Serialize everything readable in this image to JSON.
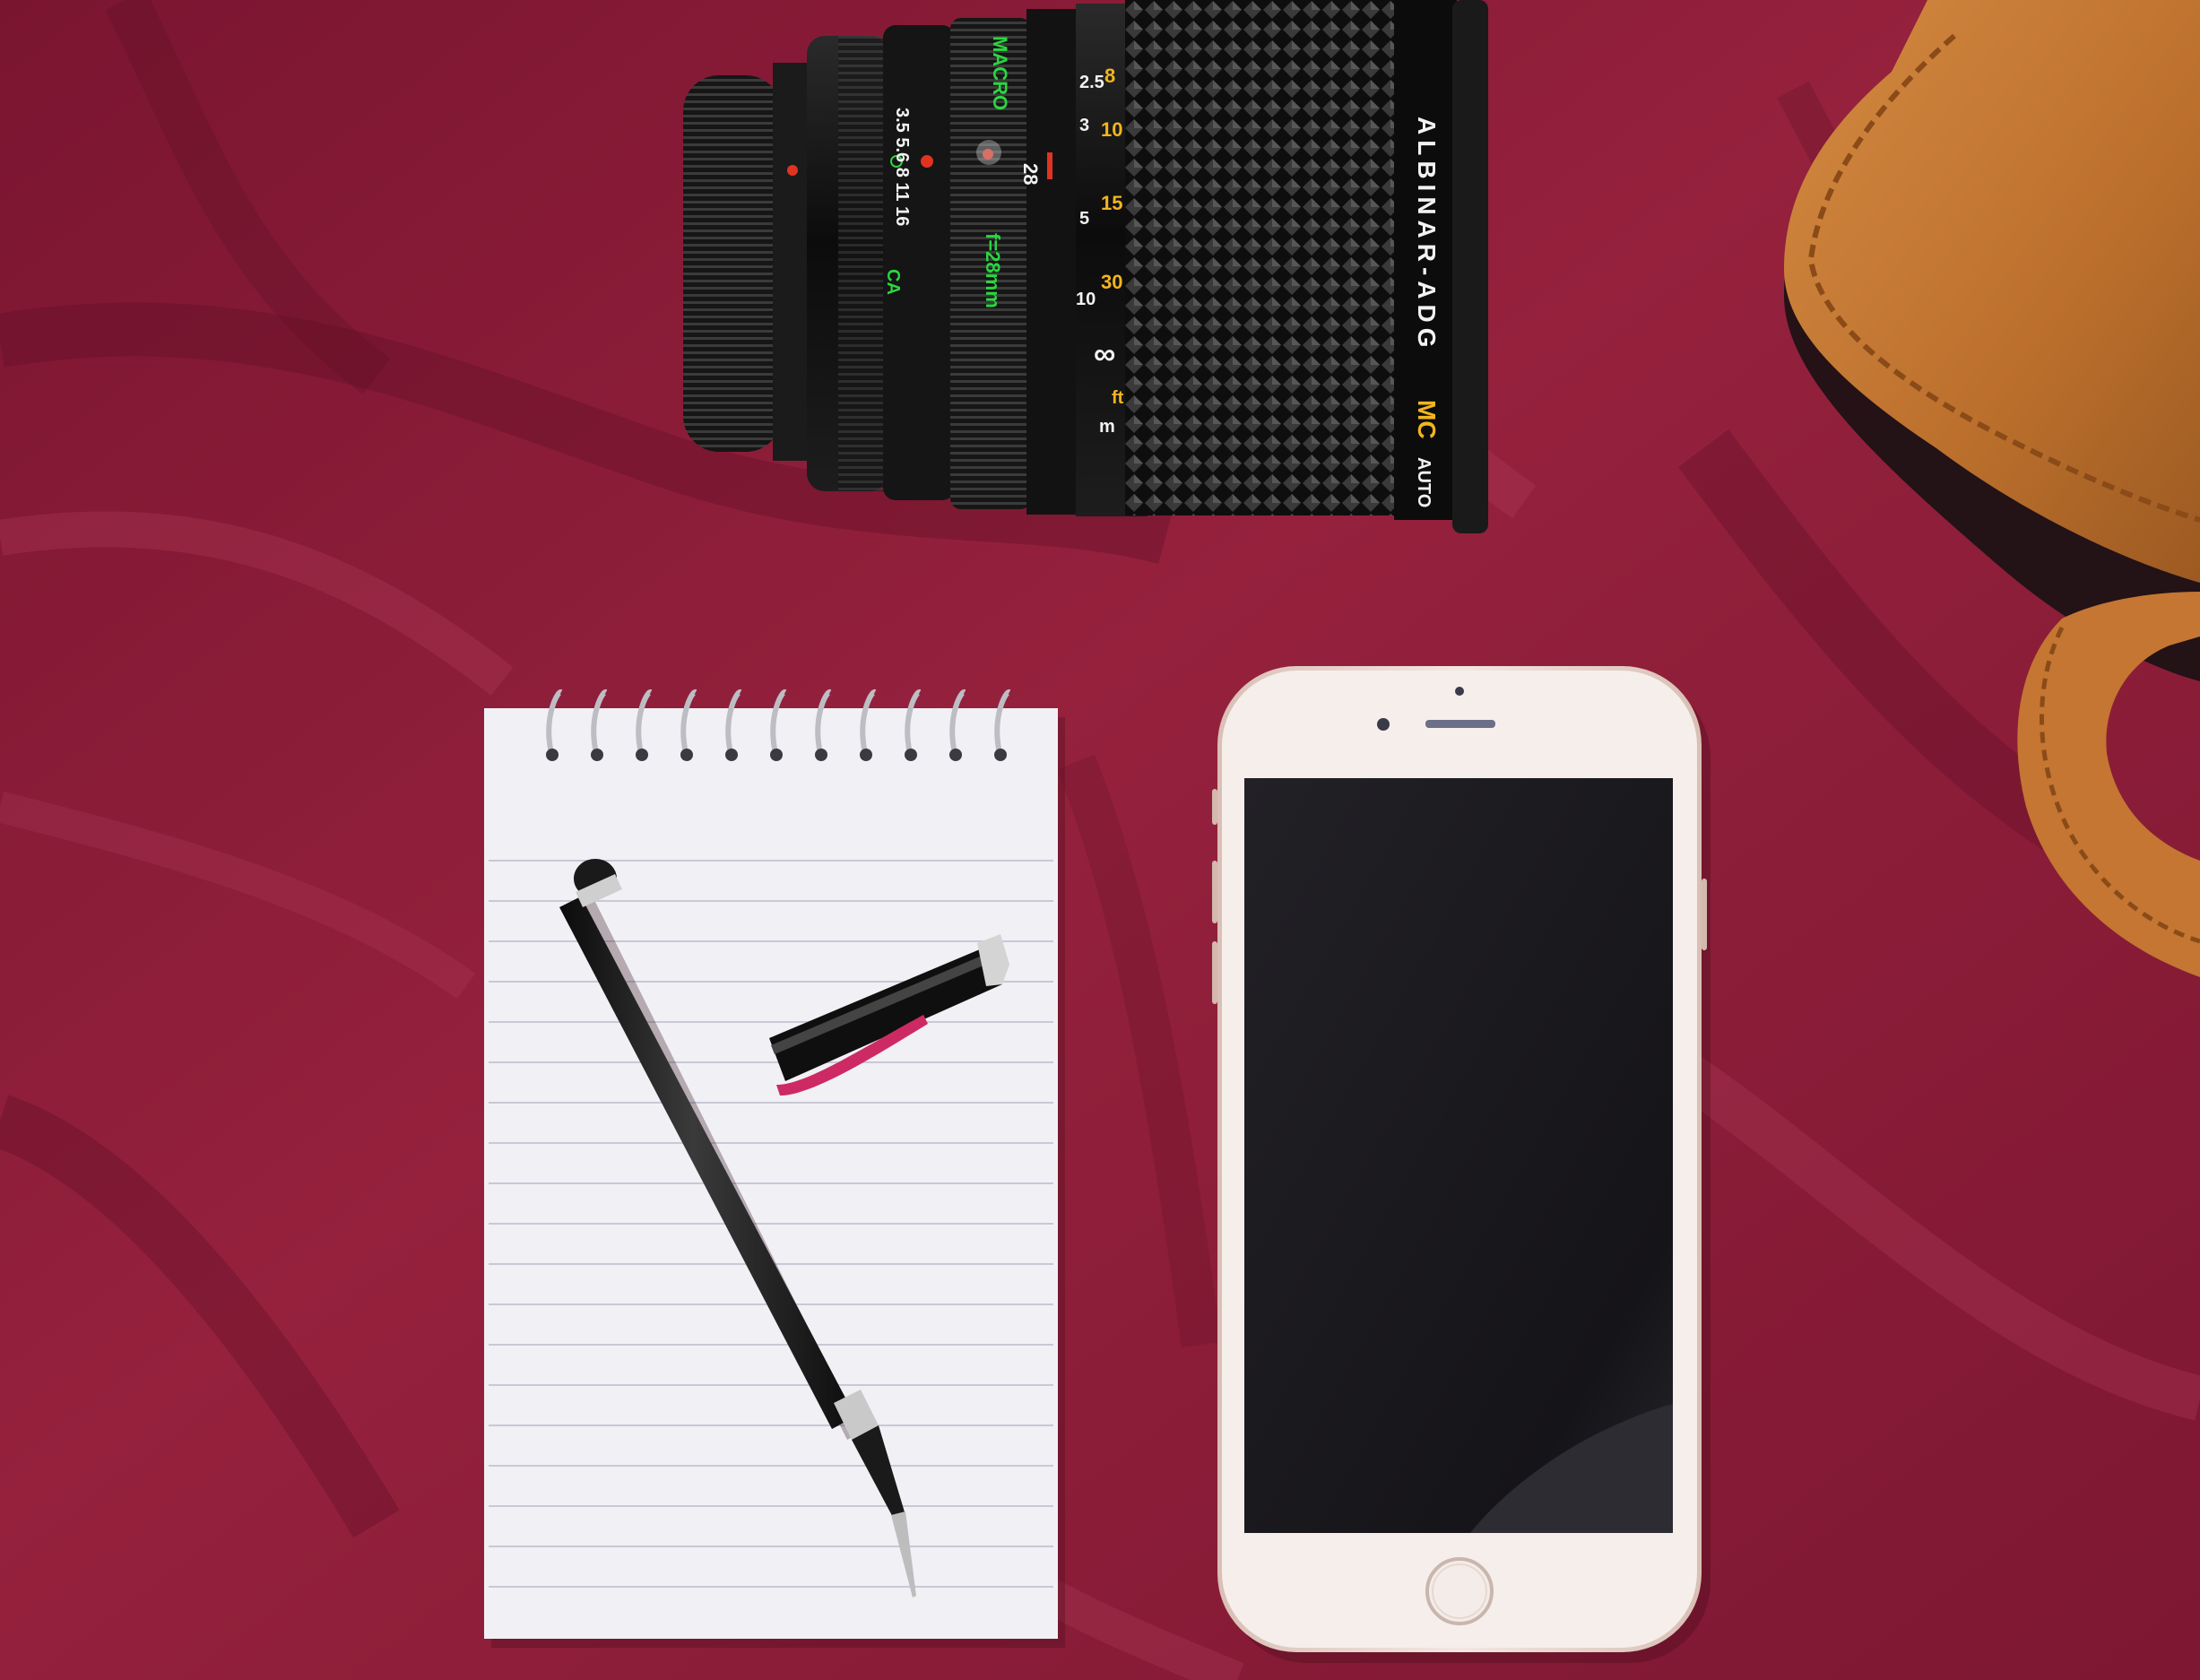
{
  "scene": {
    "description_label": "Flat lay photo",
    "objects": {
      "lens": {
        "brand_text": "ALBINAR-ADG",
        "coating_text": "MC",
        "auto_text": "AUTO",
        "macro_text": "MACRO",
        "focal_text": "f=28mm",
        "ca_text": "CA",
        "aperture_scale": "3.5 5.6 8 11 16",
        "focal_mark": "28",
        "distance_ft": [
          "8",
          "10",
          "15",
          "30",
          "∞"
        ],
        "distance_m": [
          "2.5",
          "3",
          "5",
          "10"
        ],
        "ft_label": "ft",
        "m_label": "m"
      }
    }
  },
  "colors": {
    "cloth": "#8e1f3a",
    "cloth_dark": "#6a1129",
    "cloth_light": "#a83556",
    "lens_body": "#141414",
    "notepad": "#f1f0f5",
    "phone_frame": "#ebd9d2",
    "phone_screen": "#1c1b1f",
    "bag": "#c57a35",
    "accent_green": "#2bd640",
    "accent_yellow": "#f2b51e",
    "accent_red": "#e03322"
  }
}
